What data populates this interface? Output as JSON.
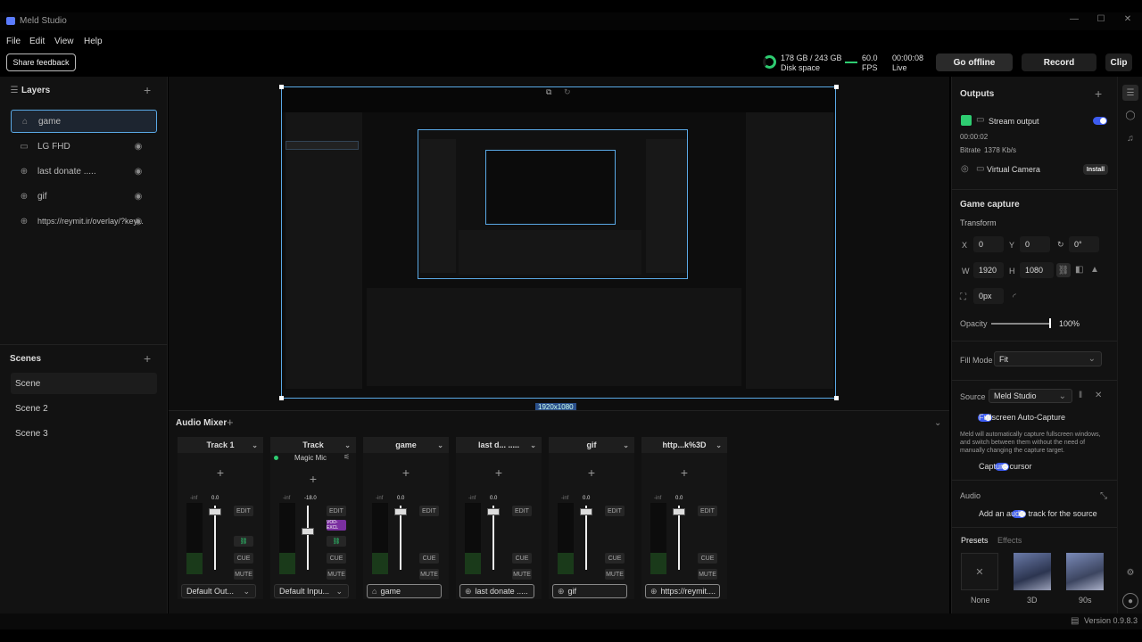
{
  "app": {
    "title": "Meld Studio",
    "version": "Version 0.9.8.3"
  },
  "menu": [
    "File",
    "Edit",
    "View",
    "Help"
  ],
  "toolbar": {
    "share_feedback": "Share feedback",
    "disk_space": "178 GB / 243 GB",
    "disk_label": "Disk space",
    "fps_value": "60.0",
    "fps_label": "FPS",
    "timer": "00:00:08",
    "live_label": "Live",
    "go_offline": "Go offline",
    "record": "Record",
    "clip": "Clip"
  },
  "layers": {
    "title": "Layers",
    "items": [
      "game",
      "LG FHD",
      "last donate .....",
      "gif",
      "https://reymit.ir/overlay/?key..."
    ]
  },
  "scenes": {
    "title": "Scenes",
    "items": [
      "Scene",
      "Scene 2",
      "Scene 3"
    ]
  },
  "canvas": {
    "resolution": "1920x1080"
  },
  "mixer": {
    "title": "Audio Mixer",
    "tracks": [
      {
        "name": "Track 1",
        "db": "0.0",
        "meter": "-inf",
        "source": "Default Out..."
      },
      {
        "name": "Track",
        "db": "-18.0",
        "meter": "-inf",
        "source": "Default Inpu...",
        "sub": "Magic Mic",
        "badge": "VOD-EXCL"
      },
      {
        "name": "game",
        "db": "0.0",
        "meter": "-inf",
        "source": "game"
      },
      {
        "name": "last d... .....",
        "db": "0.0",
        "meter": "-inf",
        "source": "last donate ....."
      },
      {
        "name": "gif",
        "db": "0.0",
        "meter": "-inf",
        "source": "gif"
      },
      {
        "name": "http...k%3D",
        "db": "0.0",
        "meter": "-inf",
        "source": "https://reymit...."
      }
    ],
    "edit": "EDIT",
    "cue": "CUE",
    "mute": "MUTE"
  },
  "outputs": {
    "title": "Outputs",
    "stream_label": "Stream output",
    "stream_time": "00:00:02",
    "bitrate_label": "Bitrate",
    "bitrate_value": "1378 Kb/s",
    "virtual_camera": "Virtual Camera",
    "install": "Install"
  },
  "props": {
    "section": "Game capture",
    "transform": "Transform",
    "x_label": "X",
    "x_value": "0",
    "y_label": "Y",
    "y_value": "0",
    "rot_value": "0°",
    "w_label": "W",
    "w_value": "1920",
    "h_label": "H",
    "h_value": "1080",
    "crop_value": "0px",
    "opacity_label": "Opacity",
    "opacity_value": "100%",
    "fill_mode_label": "Fill Mode",
    "fill_mode_value": "Fit",
    "source_label": "Source",
    "source_value": "Meld Studio",
    "fullscreen_label": "Fullscreen Auto-Capture",
    "fullscreen_desc": "Meld will automatically capture fullscreen windows, and switch between them without the need of manually changing the capture target.",
    "capture_cursor": "Capture cursor",
    "audio_label": "Audio",
    "audio_track_label": "Add an audio track for the source",
    "presets_tab": "Presets",
    "effects_tab": "Effects",
    "presets": [
      "None",
      "3D",
      "90s"
    ]
  },
  "colors": {
    "accent": "#3d5cf0",
    "selection": "#5aa9e6",
    "live_green": "#2ecc71"
  }
}
